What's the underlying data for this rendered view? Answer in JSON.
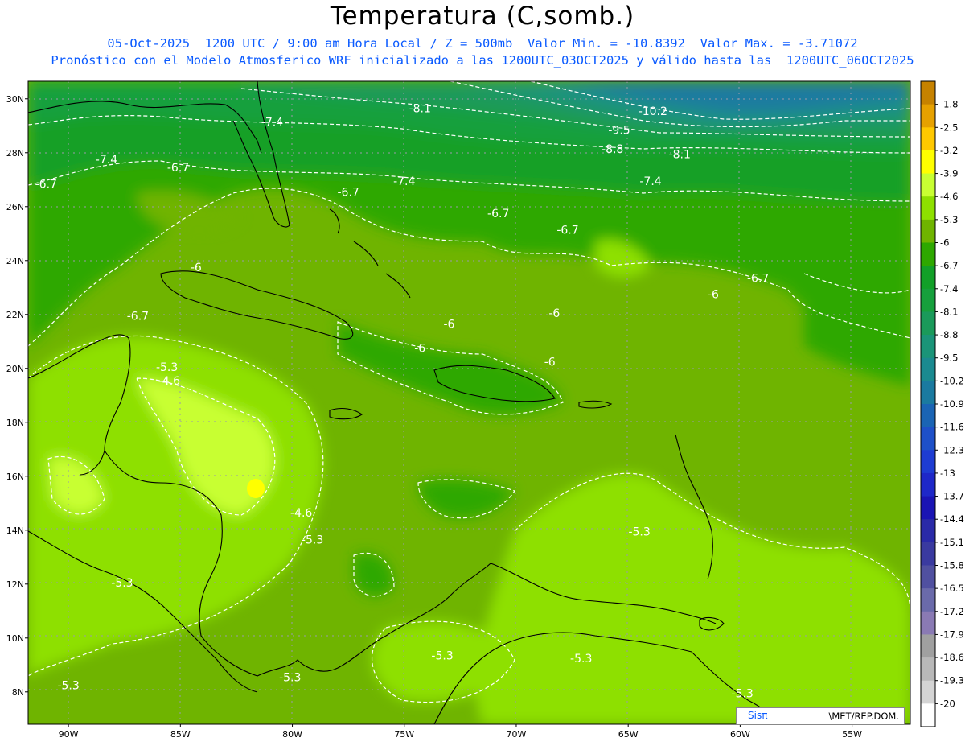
{
  "title": "Temperatura (C,somb.)",
  "subtitle_line1": "05-Oct-2025  1200 UTC / 9:00 am Hora Local / Z = 500mb  Valor Min. = -10.8392  Valor Max. = -3.71072",
  "subtitle_line2": "Pronóstico con el Modelo Atmosferico WRF inicializado a las 1200UTC_03OCT2025 y válido hasta las  1200UTC_06OCT2025",
  "map": {
    "lat_ticks": [
      "30N",
      "28N",
      "26N",
      "24N",
      "22N",
      "20N",
      "18N",
      "16N",
      "14N",
      "12N",
      "10N",
      "8N"
    ],
    "lon_ticks": [
      "90W",
      "85W",
      "80W",
      "75W",
      "70W",
      "65W",
      "60W",
      "55W"
    ],
    "contour_labels": [
      {
        "text": "-8.1",
        "lon": -74.3,
        "lat": 29.5
      },
      {
        "text": "-10.2",
        "lon": -63.9,
        "lat": 29.4
      },
      {
        "text": "-9.5",
        "lon": -65.4,
        "lat": 28.7
      },
      {
        "text": "-8.8",
        "lon": -65.7,
        "lat": 28.0
      },
      {
        "text": "-8.1",
        "lon": -62.7,
        "lat": 27.8
      },
      {
        "text": "-7.4",
        "lon": -80.9,
        "lat": 29.0
      },
      {
        "text": "-7.4",
        "lon": -88.3,
        "lat": 27.6
      },
      {
        "text": "-6.7",
        "lon": -85.1,
        "lat": 27.3
      },
      {
        "text": "-6.7",
        "lon": -91.0,
        "lat": 26.7
      },
      {
        "text": "-6.7",
        "lon": -77.5,
        "lat": 26.4
      },
      {
        "text": "-7.4",
        "lon": -75.0,
        "lat": 26.8
      },
      {
        "text": "-7.4",
        "lon": -64.0,
        "lat": 26.8
      },
      {
        "text": "-6.7",
        "lon": -70.8,
        "lat": 25.6
      },
      {
        "text": "-6.7",
        "lon": -67.7,
        "lat": 25.0
      },
      {
        "text": "-6",
        "lon": -84.3,
        "lat": 23.6
      },
      {
        "text": "-6.7",
        "lon": -59.2,
        "lat": 23.2
      },
      {
        "text": "-6",
        "lon": -61.2,
        "lat": 22.6
      },
      {
        "text": "-6.7",
        "lon": -86.9,
        "lat": 21.8
      },
      {
        "text": "-6",
        "lon": -73.0,
        "lat": 21.5
      },
      {
        "text": "-6",
        "lon": -68.3,
        "lat": 21.9
      },
      {
        "text": "-6",
        "lon": -74.3,
        "lat": 20.6
      },
      {
        "text": "-6",
        "lon": -68.5,
        "lat": 20.1
      },
      {
        "text": "-5.3",
        "lon": -85.6,
        "lat": 19.9
      },
      {
        "text": "-4.6",
        "lon": -85.5,
        "lat": 19.4
      },
      {
        "text": "-4.6",
        "lon": -79.6,
        "lat": 14.5
      },
      {
        "text": "-5.3",
        "lon": -79.1,
        "lat": 13.5
      },
      {
        "text": "-5.3",
        "lon": -64.5,
        "lat": 13.8
      },
      {
        "text": "-5.3",
        "lon": -87.6,
        "lat": 11.9
      },
      {
        "text": "-5.3",
        "lon": -73.3,
        "lat": 9.2
      },
      {
        "text": "-5.3",
        "lon": -67.1,
        "lat": 9.1
      },
      {
        "text": "-5.3",
        "lon": -80.1,
        "lat": 8.4
      },
      {
        "text": "-5.3",
        "lon": -90.0,
        "lat": 8.1
      },
      {
        "text": "-5.3",
        "lon": -59.9,
        "lat": 7.8
      }
    ]
  },
  "colorbar": {
    "levels": [
      "-1.8",
      "-2.5",
      "-3.2",
      "-3.9",
      "-4.6",
      "-5.3",
      "-6",
      "-6.7",
      "-7.4",
      "-8.1",
      "-8.8",
      "-9.5",
      "-10.2",
      "-10.9",
      "-11.6",
      "-12.3",
      "-13",
      "-13.7",
      "-14.4",
      "-15.1",
      "-15.8",
      "-16.5",
      "-17.2",
      "-17.9",
      "-18.6",
      "-19.3",
      "-20"
    ],
    "colors": [
      "#c68200",
      "#e6a100",
      "#ffc800",
      "#ffff00",
      "#c8ff32",
      "#8ee000",
      "#6fb400",
      "#2ea800",
      "#12a028",
      "#16a03c",
      "#1a9a5a",
      "#1a9478",
      "#1a8a90",
      "#1a7aa0",
      "#1a64b4",
      "#1e50c8",
      "#1e3cd2",
      "#1e28c8",
      "#1a14b4",
      "#2a2aa8",
      "#3a3aa0",
      "#5050a0",
      "#6a6aaa",
      "#8a7ab4",
      "#a0a0a0",
      "#b8b8b8",
      "#d4d4d4",
      "#ffffff"
    ]
  },
  "credit": {
    "brand": "Sisπ",
    "org": "\\MET/REP.DOM."
  }
}
